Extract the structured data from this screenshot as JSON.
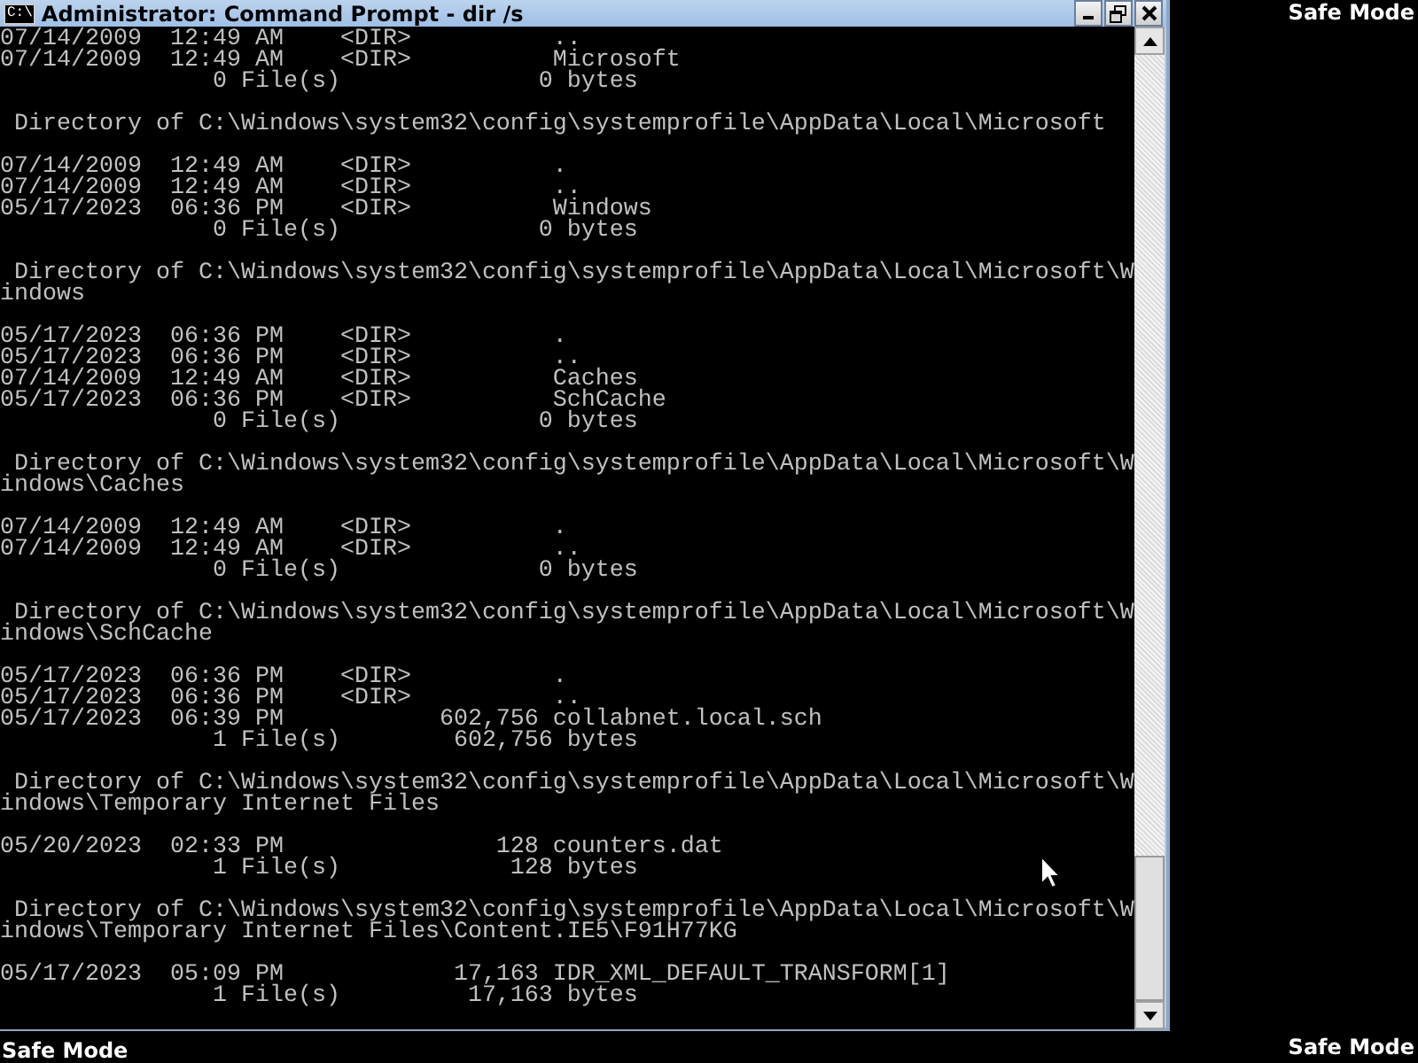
{
  "desktop": {
    "top_right_label": "Safe Mode",
    "bottom_right_label": "Safe Mode",
    "bottom_left_label": "Safe Mode"
  },
  "window": {
    "title": "Administrator: Command Prompt - dir /s",
    "icon_text": "C:\\"
  },
  "console": {
    "blocks": [
      [
        "07/14/2009  12:49 AM    <DIR>          ..",
        "07/14/2009  12:49 AM    <DIR>          Microsoft",
        "               0 File(s)              0 bytes"
      ],
      [
        " Directory of C:\\Windows\\system32\\config\\systemprofile\\AppData\\Local\\Microsoft"
      ],
      [
        "07/14/2009  12:49 AM    <DIR>          .",
        "07/14/2009  12:49 AM    <DIR>          ..",
        "05/17/2023  06:36 PM    <DIR>          Windows",
        "               0 File(s)              0 bytes"
      ],
      [
        " Directory of C:\\Windows\\system32\\config\\systemprofile\\AppData\\Local\\Microsoft\\W",
        "indows"
      ],
      [
        "05/17/2023  06:36 PM    <DIR>          .",
        "05/17/2023  06:36 PM    <DIR>          ..",
        "07/14/2009  12:49 AM    <DIR>          Caches",
        "05/17/2023  06:36 PM    <DIR>          SchCache",
        "               0 File(s)              0 bytes"
      ],
      [
        " Directory of C:\\Windows\\system32\\config\\systemprofile\\AppData\\Local\\Microsoft\\W",
        "indows\\Caches"
      ],
      [
        "07/14/2009  12:49 AM    <DIR>          .",
        "07/14/2009  12:49 AM    <DIR>          ..",
        "               0 File(s)              0 bytes"
      ],
      [
        " Directory of C:\\Windows\\system32\\config\\systemprofile\\AppData\\Local\\Microsoft\\W",
        "indows\\SchCache"
      ],
      [
        "05/17/2023  06:36 PM    <DIR>          .",
        "05/17/2023  06:36 PM    <DIR>          ..",
        "05/17/2023  06:39 PM           602,756 collabnet.local.sch",
        "               1 File(s)        602,756 bytes"
      ],
      [
        " Directory of C:\\Windows\\system32\\config\\systemprofile\\AppData\\Local\\Microsoft\\W",
        "indows\\Temporary Internet Files"
      ],
      [
        "05/20/2023  02:33 PM               128 counters.dat",
        "               1 File(s)            128 bytes"
      ],
      [
        " Directory of C:\\Windows\\system32\\config\\systemprofile\\AppData\\Local\\Microsoft\\W",
        "indows\\Temporary Internet Files\\Content.IE5\\F91H77KG"
      ],
      [
        "05/17/2023  05:09 PM            17,163 IDR_XML_DEFAULT_TRANSFORM[1]",
        "               1 File(s)         17,163 bytes"
      ]
    ]
  }
}
